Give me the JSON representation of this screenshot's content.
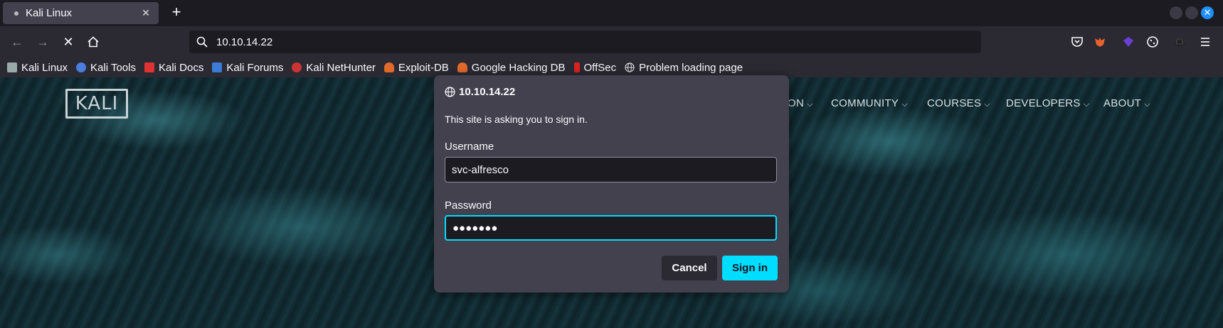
{
  "tab": {
    "title": "Kali Linux",
    "close": "✕"
  },
  "newtab": "+",
  "window": {
    "close_glyph": "✕"
  },
  "nav": {
    "back": "←",
    "forward": "→",
    "stop": "✕",
    "home": "⌂"
  },
  "urlbar": {
    "value": "10.10.14.22"
  },
  "bookmarks": [
    {
      "label": "Kali Linux",
      "color": "#9aa"
    },
    {
      "label": "Kali Tools",
      "color": "#4a7de0"
    },
    {
      "label": "Kali Docs",
      "color": "#d33"
    },
    {
      "label": "Kali Forums",
      "color": "#3c7bd6"
    },
    {
      "label": "Kali NetHunter",
      "color": "#c33"
    },
    {
      "label": "Exploit-DB",
      "color": "#e06a2a"
    },
    {
      "label": "Google Hacking DB",
      "color": "#e06a2a"
    },
    {
      "label": "OffSec",
      "color": "#d22"
    },
    {
      "label": "Problem loading page",
      "color": "#ccc"
    }
  ],
  "site": {
    "logo": "KALI",
    "nav": [
      "ON",
      "COMMUNITY",
      "COURSES",
      "DEVELOPERS",
      "ABOUT"
    ]
  },
  "dialog": {
    "host": "10.10.14.22",
    "message": "This site is asking you to sign in.",
    "username_label": "Username",
    "username_value": "svc-alfresco",
    "password_label": "Password",
    "password_value": "●●●●●●●",
    "cancel": "Cancel",
    "signin": "Sign in"
  },
  "colors": {
    "accent": "#00ddff",
    "dialog_bg": "#42414d",
    "toolbar_bg": "#2b2a33"
  }
}
